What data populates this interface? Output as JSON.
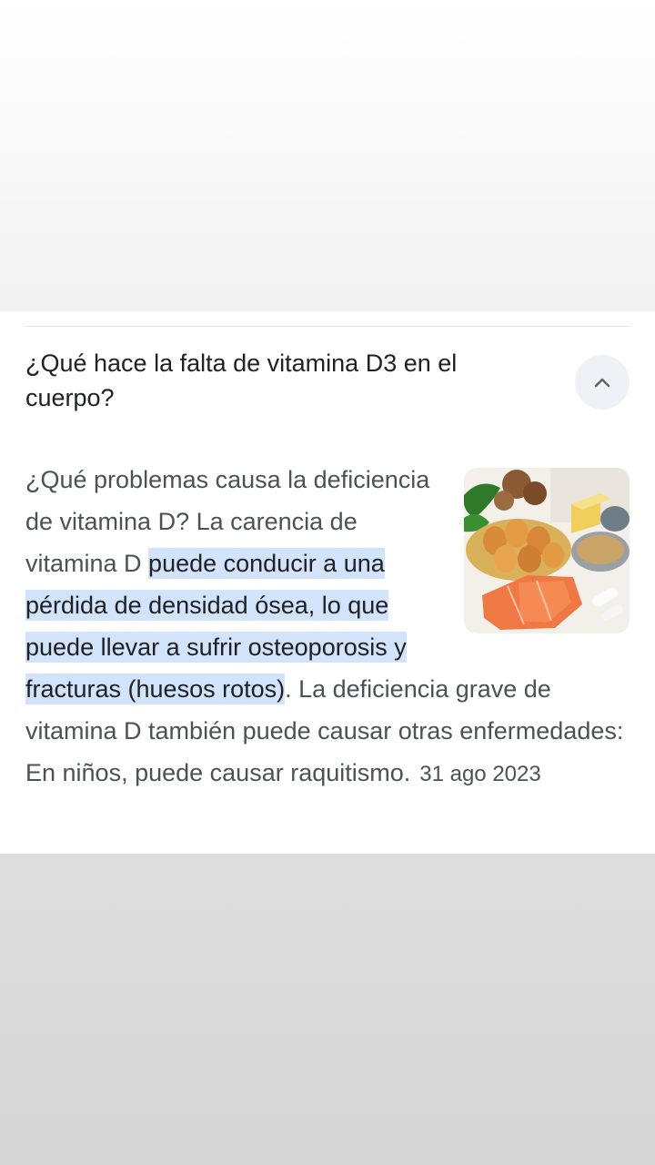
{
  "faq": {
    "question": "¿Qué hace la falta de vitamina D3 en el cuerpo?",
    "answer_before_highlight": "¿Qué problemas causa la deficiencia de vitamina D? La carencia de vitamina D ",
    "answer_highlight": "puede conducir a una pérdida de densidad ósea, lo que puede llevar a sufrir osteoporosis y fracturas (huesos rotos)",
    "answer_after_highlight": ". La deficiencia grave de vitamina D también puede causar otras enfermedades: En niños, puede causar raquitismo.",
    "date": "31 ago 2023",
    "toggle_icon": "chevron-up-icon",
    "image_icon": "vitamin-d-foods-photo"
  },
  "colors": {
    "highlight": "#d2e3fc",
    "question_text": "#202124",
    "answer_text": "#4d5156",
    "toggle_bg": "#eef2f7"
  }
}
